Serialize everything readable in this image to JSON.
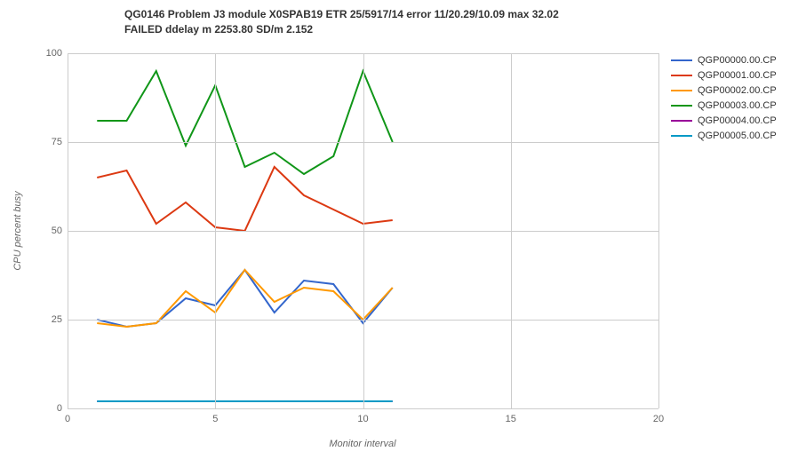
{
  "chart_data": {
    "type": "line",
    "title": "QG0146 Problem J3 module X0SPAB19 ETR 25/5917/14 error 11/20.29/10.09 max 32.02\nFAILED ddelay m 2253.80 SD/m 2.152",
    "xlabel": "Monitor interval",
    "ylabel": "CPU percent busy",
    "xlim": [
      0,
      20
    ],
    "ylim": [
      0,
      100
    ],
    "x_ticks": [
      0,
      5,
      10,
      15,
      20
    ],
    "y_ticks": [
      0,
      25,
      50,
      75,
      100
    ],
    "x": [
      1,
      2,
      3,
      4,
      5,
      6,
      7,
      8,
      9,
      10,
      11
    ],
    "series": [
      {
        "name": "QGP00000.00.CP",
        "color": "#3366cc",
        "values": [
          25,
          23,
          24,
          31,
          29,
          39,
          27,
          36,
          35,
          24,
          34
        ]
      },
      {
        "name": "QGP00001.00.CP",
        "color": "#dc3912",
        "values": [
          65,
          67,
          52,
          58,
          51,
          50,
          68,
          60,
          56,
          52,
          53
        ]
      },
      {
        "name": "QGP00002.00.CP",
        "color": "#ff9900",
        "values": [
          24,
          23,
          24,
          33,
          27,
          39,
          30,
          34,
          33,
          25,
          34
        ]
      },
      {
        "name": "QGP00003.00.CP",
        "color": "#109618",
        "values": [
          81,
          81,
          95,
          74,
          91,
          68,
          72,
          66,
          71,
          95,
          75
        ]
      },
      {
        "name": "QGP00004.00.CP",
        "color": "#990099",
        "values": [
          2,
          2,
          2,
          2,
          2,
          2,
          2,
          2,
          2,
          2,
          2
        ]
      },
      {
        "name": "QGP00005.00.CP",
        "color": "#0099c6",
        "values": [
          2,
          2,
          2,
          2,
          2,
          2,
          2,
          2,
          2,
          2,
          2
        ]
      }
    ]
  }
}
